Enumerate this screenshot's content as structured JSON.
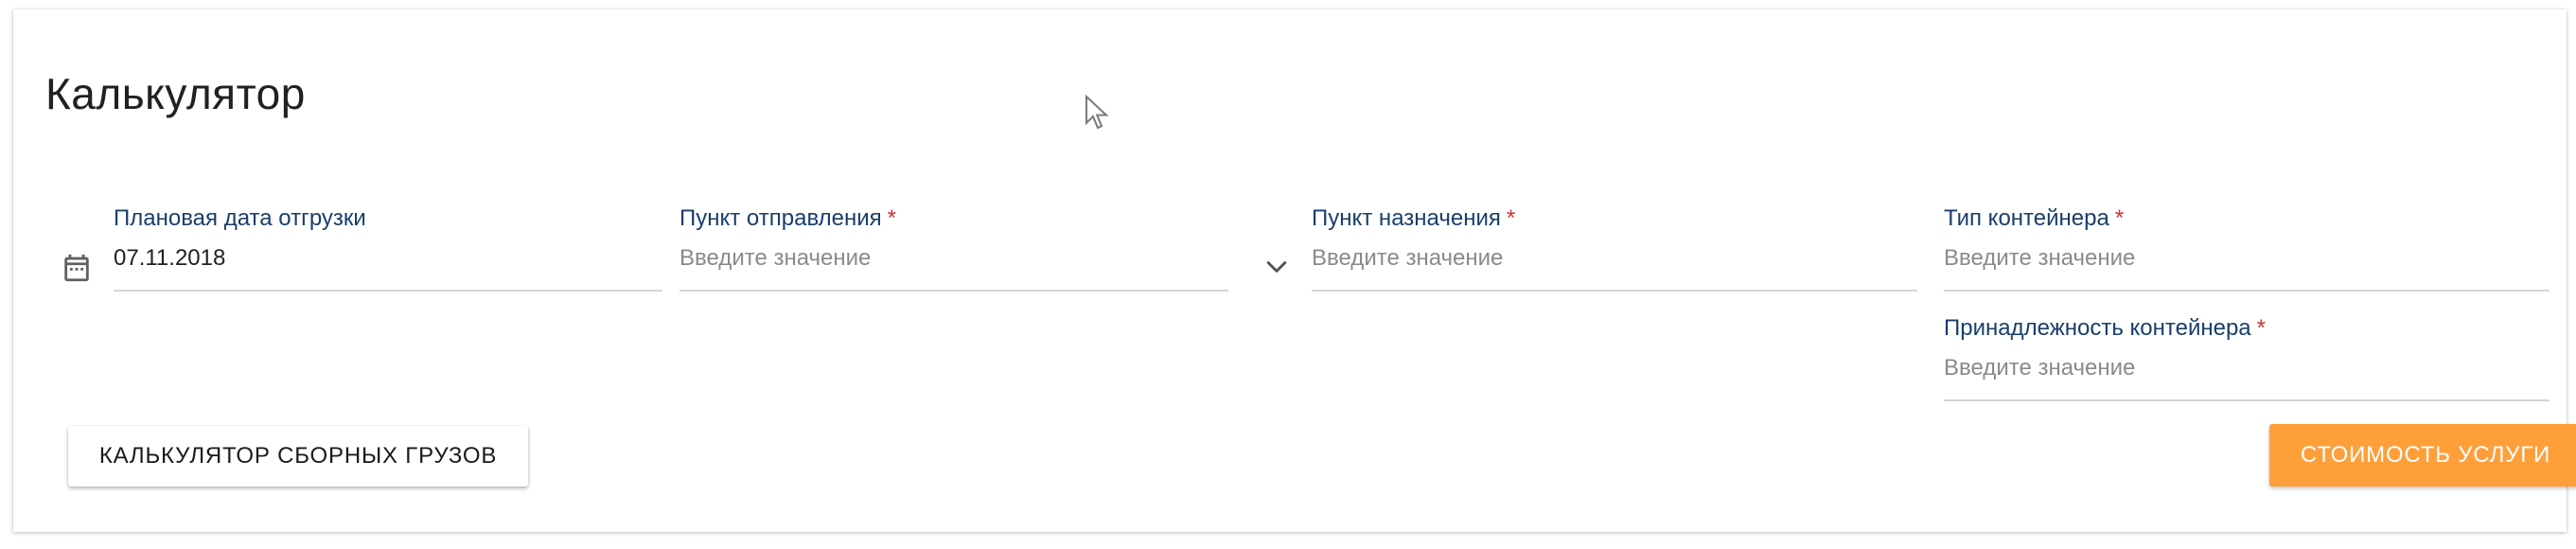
{
  "card": {
    "title": "Калькулятор"
  },
  "fields": {
    "shipment_date": {
      "label": "Плановая дата отгрузки",
      "value": "07.11.2018",
      "icon": "calendar-icon"
    },
    "departure_point": {
      "label": "Пункт отправления",
      "required_mark": "*",
      "placeholder": "Введите значение",
      "icon": "chevron-down-icon"
    },
    "destination_point": {
      "label": "Пункт назначения",
      "required_mark": "*",
      "placeholder": "Введите значение"
    },
    "container_type": {
      "label": "Тип контейнера",
      "required_mark": "*",
      "placeholder": "Введите значение"
    },
    "container_ownership": {
      "label": "Принадлежность контейнера",
      "required_mark": "*",
      "placeholder": "Введите значение"
    }
  },
  "buttons": {
    "groupage_calculator_label": "КАЛЬКУЛЯТОР СБОРНЫХ ГРУЗОВ",
    "service_cost_label": "СТОИМОСТЬ УСЛУГИ"
  },
  "colors": {
    "label": "#1a3e6b",
    "required": "#d32f2f",
    "placeholder": "#8a8a8a",
    "accent": "#ff9f3a",
    "underline": "#d6d6d6"
  }
}
